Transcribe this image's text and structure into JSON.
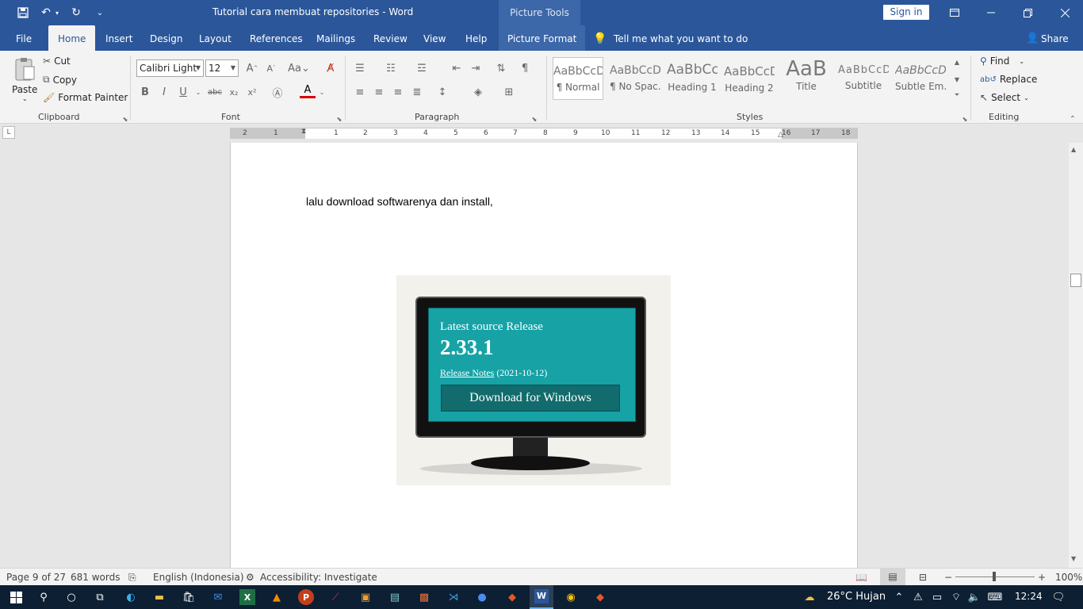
{
  "app": {
    "title": "Tutorial cara membuat repositories  -  Word",
    "context_title": "Picture Tools",
    "sign_in": "Sign in"
  },
  "quick_access": {
    "save_icon": "save-icon",
    "undo_icon": "undo-icon",
    "redo_icon": "redo-icon",
    "customize_icon": "chevron-down-icon"
  },
  "tabs": [
    {
      "label": "File"
    },
    {
      "label": "Home"
    },
    {
      "label": "Insert"
    },
    {
      "label": "Design"
    },
    {
      "label": "Layout"
    },
    {
      "label": "References"
    },
    {
      "label": "Mailings"
    },
    {
      "label": "Review"
    },
    {
      "label": "View"
    },
    {
      "label": "Help"
    },
    {
      "label": "Picture Format"
    }
  ],
  "tell_me": "Tell me what you want to do",
  "share": "Share",
  "clipboard": {
    "paste": "Paste",
    "cut": "Cut",
    "copy": "Copy",
    "format_painter": "Format Painter",
    "label": "Clipboard"
  },
  "font": {
    "name": "Calibri Light",
    "size": "12",
    "label": "Font"
  },
  "paragraph": {
    "label": "Paragraph"
  },
  "styles": {
    "label": "Styles",
    "items": [
      {
        "preview": "AaBbCcD",
        "name": "¶ Normal"
      },
      {
        "preview": "AaBbCcD",
        "name": "¶ No Spac..."
      },
      {
        "preview": "AaBbCc",
        "name": "Heading 1"
      },
      {
        "preview": "AaBbCcD",
        "name": "Heading 2"
      },
      {
        "preview": "AaB",
        "name": "Title"
      },
      {
        "preview": "AaBbCcD",
        "name": "Subtitle"
      },
      {
        "preview": "AaBbCcD",
        "name": "Subtle Em..."
      }
    ]
  },
  "editing": {
    "find": "Find",
    "replace": "Replace",
    "select": "Select",
    "label": "Editing"
  },
  "ruler": {
    "ticks": [
      "2",
      "1",
      "1",
      "2",
      "3",
      "4",
      "5",
      "6",
      "7",
      "8",
      "9",
      "10",
      "11",
      "12",
      "13",
      "14",
      "15",
      "16",
      "17",
      "18"
    ]
  },
  "document": {
    "text": "lalu download softwarenya dan install,"
  },
  "image": {
    "title": "Latest source Release",
    "version": "2.33.1",
    "notes_link": "Release Notes",
    "notes_date": "(2021-10-12)",
    "button": "Download for Windows"
  },
  "status": {
    "page": "Page 9 of 27",
    "words": "681 words",
    "language": "English (Indonesia)",
    "accessibility": "Accessibility: Investigate",
    "zoom": "100%"
  },
  "taskbar": {
    "weather": "26°C  Hujan",
    "time": "12:24"
  }
}
